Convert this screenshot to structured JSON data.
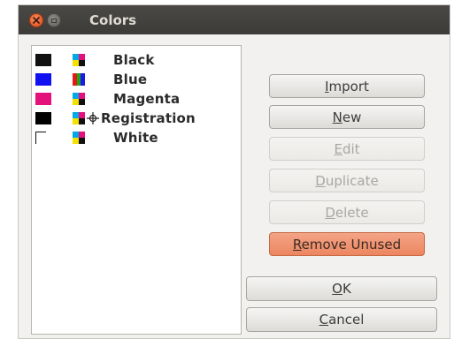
{
  "window": {
    "title": "Colors"
  },
  "colors": [
    {
      "name": "Black",
      "swatch": "#111111",
      "kind": "process",
      "registration": false
    },
    {
      "name": "Blue",
      "swatch": "#1010f0",
      "kind": "spot",
      "registration": false
    },
    {
      "name": "Magenta",
      "swatch": "#e4117d",
      "kind": "process",
      "registration": false
    },
    {
      "name": "Registration",
      "swatch": "#000000",
      "kind": "process",
      "registration": true
    },
    {
      "name": "White",
      "swatch": "#ffffff",
      "kind": "process",
      "registration": false
    }
  ],
  "buttons": {
    "import": {
      "label": "Import",
      "mnemonic_index": 0,
      "enabled": true
    },
    "new": {
      "label": "New",
      "mnemonic_index": 0,
      "enabled": true
    },
    "edit": {
      "label": "Edit",
      "mnemonic_index": 0,
      "enabled": false
    },
    "duplicate": {
      "label": "Duplicate",
      "mnemonic_index": 0,
      "enabled": false
    },
    "delete": {
      "label": "Delete",
      "mnemonic_index": 0,
      "enabled": false
    },
    "remove_unused": {
      "label": "Remove Unused",
      "mnemonic_index": 0,
      "enabled": true
    },
    "ok": {
      "label": "OK",
      "mnemonic_index": 0,
      "enabled": true
    },
    "cancel": {
      "label": "Cancel",
      "mnemonic_index": 0,
      "enabled": true
    }
  },
  "accent_colors": {
    "titlebar": "#3c3b37",
    "close_button": "#df4b16",
    "remove_unused_button": "#ec8660"
  }
}
